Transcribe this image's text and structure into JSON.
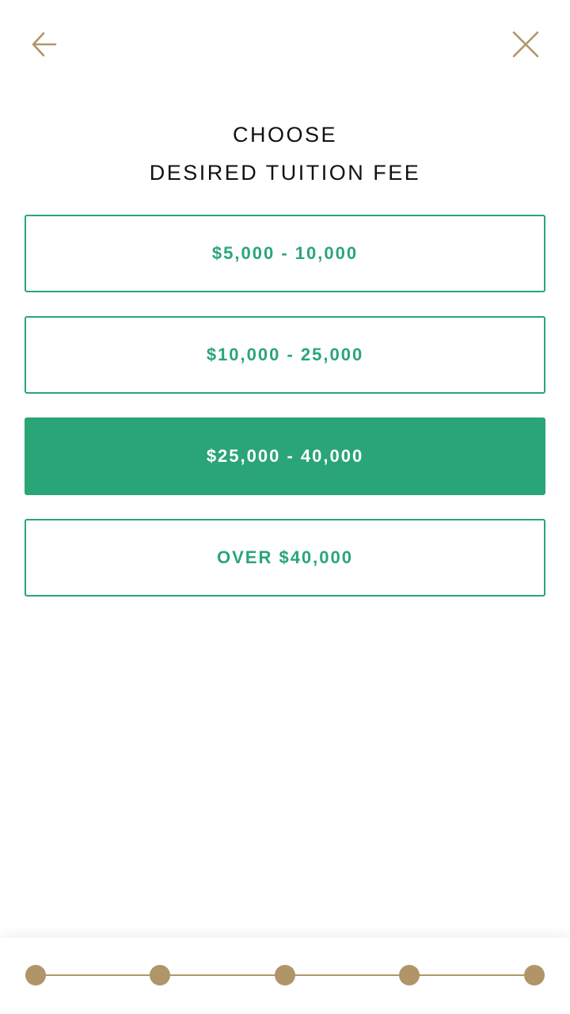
{
  "header": {
    "back_icon": "arrow-left-icon",
    "close_icon": "close-icon",
    "icon_color": "#b09569"
  },
  "title": {
    "line1": "CHOOSE",
    "line2": "DESIRED TUITION FEE"
  },
  "options": [
    {
      "label": "$5,000 - 10,000",
      "selected": false
    },
    {
      "label": "$10,000 - 25,000",
      "selected": false
    },
    {
      "label": "$25,000 - 40,000",
      "selected": true
    },
    {
      "label": "OVER $40,000",
      "selected": false
    }
  ],
  "colors": {
    "accent": "#2aa578",
    "progress": "#b09569",
    "title_text": "#111111"
  },
  "progress": {
    "total_steps": 5,
    "completed_steps": 5
  }
}
